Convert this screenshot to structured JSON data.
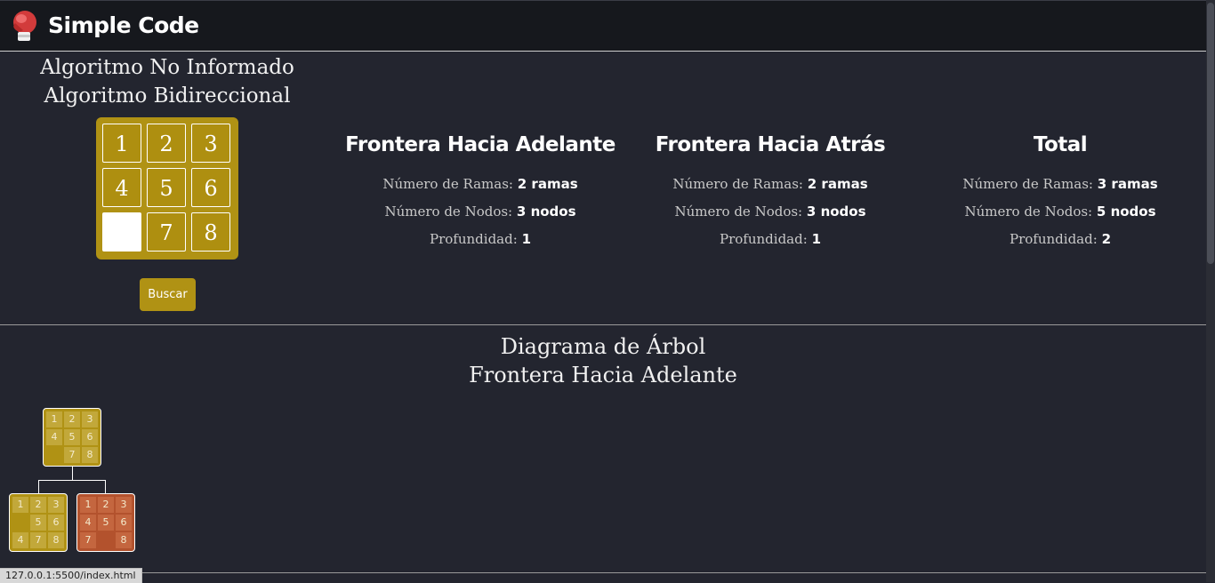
{
  "brand": {
    "name": "Simple Code",
    "icon": "boxing-glove-icon"
  },
  "header": {
    "line1": "Algoritmo No Informado",
    "line2": "Algoritmo Bidireccional"
  },
  "puzzle": {
    "cells": [
      "1",
      "2",
      "3",
      "4",
      "5",
      "6",
      "",
      "7",
      "8"
    ]
  },
  "search_button": "Buscar",
  "stats": [
    {
      "title": "Frontera Hacia Adelante",
      "ramas_label": "Número de Ramas:",
      "ramas": "2 ramas",
      "nodos_label": "Número de Nodos:",
      "nodos": "3 nodos",
      "prof_label": "Profundidad:",
      "prof": "1"
    },
    {
      "title": "Frontera Hacia Atrás",
      "ramas_label": "Número de Ramas:",
      "ramas": "2 ramas",
      "nodos_label": "Número de Nodos:",
      "nodos": "3 nodos",
      "prof_label": "Profundidad:",
      "prof": "1"
    },
    {
      "title": "Total",
      "ramas_label": "Número de Ramas:",
      "ramas": "3 ramas",
      "nodos_label": "Número de Nodos:",
      "nodos": "5 nodos",
      "prof_label": "Profundidad:",
      "prof": "2"
    }
  ],
  "tree": {
    "title1": "Diagrama de Árbol",
    "title2": "Frontera Hacia Adelante",
    "nodes": [
      {
        "style": "gold",
        "cells": [
          "1",
          "2",
          "3",
          "4",
          "5",
          "6",
          "",
          "7",
          "8"
        ]
      },
      {
        "style": "gold",
        "cells": [
          "1",
          "2",
          "3",
          "",
          "5",
          "6",
          "4",
          "7",
          "8"
        ]
      },
      {
        "style": "red",
        "cells": [
          "1",
          "2",
          "3",
          "4",
          "5",
          "6",
          "7",
          "",
          "8"
        ]
      }
    ]
  },
  "colors": {
    "accent": "#b09214",
    "node_visited": "#b3522d",
    "background": "#23252f",
    "navbar": "#16181d"
  },
  "status_bar": {
    "url": "127.0.0.1:5500/index.html"
  }
}
